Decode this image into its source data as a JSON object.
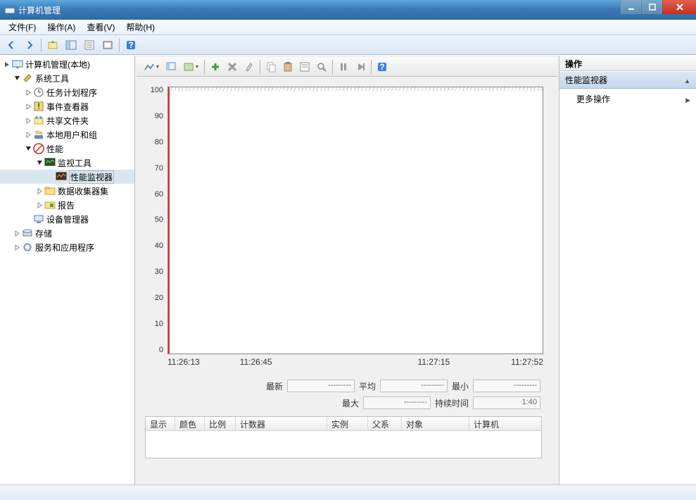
{
  "title": "计算机管理",
  "menu": {
    "file": "文件(F)",
    "action": "操作(A)",
    "view": "查看(V)",
    "help": "帮助(H)"
  },
  "tree": {
    "root": "计算机管理(本地)",
    "systools": "系统工具",
    "tasksched": "任务计划程序",
    "eventvwr": "事件查看器",
    "shared": "共享文件夹",
    "localusers": "本地用户和组",
    "perf": "性能",
    "montools": "监视工具",
    "perfmon": "性能监视器",
    "datacollect": "数据收集器集",
    "reports": "报告",
    "devmgr": "设备管理器",
    "storage": "存储",
    "services": "服务和应用程序"
  },
  "chart_data": {
    "type": "line",
    "title": "",
    "xlabel": "",
    "ylabel": "",
    "ylim": [
      0,
      100
    ],
    "yticks": [
      100,
      90,
      80,
      70,
      60,
      50,
      40,
      30,
      20,
      10,
      0
    ],
    "xticks": [
      "11:26:13",
      "11:26:45",
      "11:27:15",
      "11:27:52"
    ],
    "series": []
  },
  "stats": {
    "latest_label": "最新",
    "latest": "---------",
    "avg_label": "平均",
    "avg": "---------",
    "min_label": "最小",
    "min": "---------",
    "max_label": "最大",
    "max": "---------",
    "duration_label": "持续时间",
    "duration": "1:40"
  },
  "counter_cols": {
    "show": "显示",
    "color": "颜色",
    "scale": "比例",
    "counter": "计数器",
    "instance": "实例",
    "parent": "父系",
    "object": "对象",
    "computer": "计算机"
  },
  "actions": {
    "header": "操作",
    "section": "性能监视器",
    "more": "更多操作"
  }
}
